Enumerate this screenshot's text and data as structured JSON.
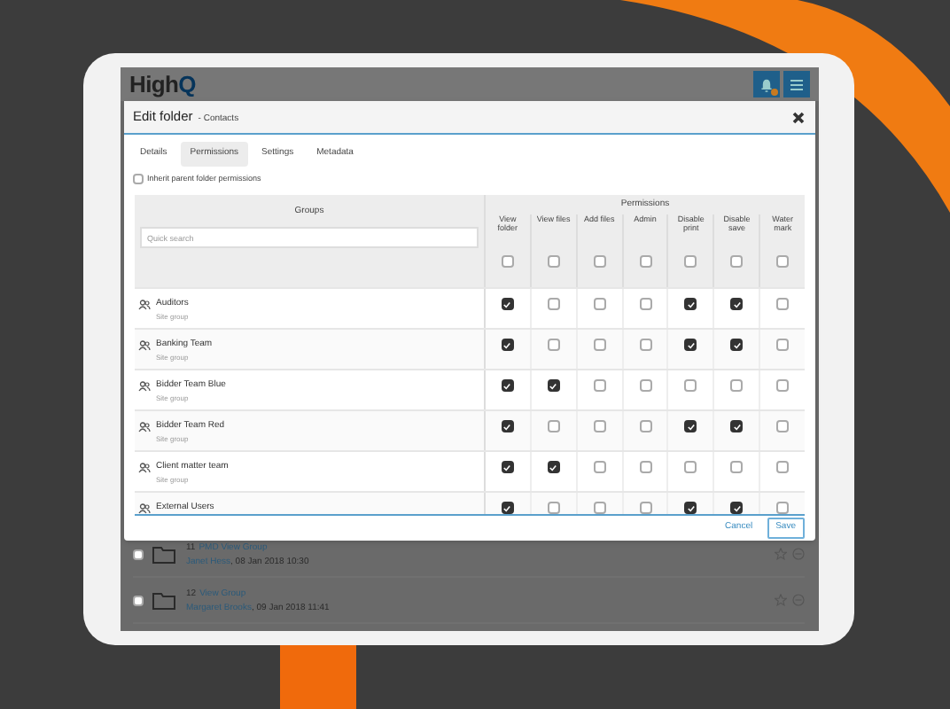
{
  "app": {
    "logo": "High",
    "logo_accent": "Q",
    "notification_badge": true
  },
  "dialog": {
    "title": "Edit folder",
    "subtitle": "- Contacts",
    "tabs": [
      {
        "label": "Details",
        "selected": false
      },
      {
        "label": "Permissions",
        "selected": true
      },
      {
        "label": "Settings",
        "selected": false
      },
      {
        "label": "Metadata",
        "selected": false
      }
    ],
    "inherit": {
      "label": "Inherit parent folder permissions",
      "checked": false
    },
    "table": {
      "groups_heading": "Groups",
      "permissions_heading": "Permissions",
      "search": {
        "placeholder": "Quick search"
      },
      "columns": [
        {
          "label": "View folder",
          "checked": false
        },
        {
          "label": "View files",
          "checked": false
        },
        {
          "label": "Add files",
          "checked": false
        },
        {
          "label": "Admin",
          "checked": false
        },
        {
          "label": "Disable print",
          "checked": false
        },
        {
          "label": "Disable save",
          "checked": false
        },
        {
          "label": "Water mark",
          "checked": false
        }
      ],
      "rows": [
        {
          "name": "Auditors",
          "type": "Site group",
          "perms": [
            true,
            false,
            false,
            false,
            true,
            true,
            false
          ]
        },
        {
          "name": "Banking Team",
          "type": "Site group",
          "perms": [
            true,
            false,
            false,
            false,
            true,
            true,
            false
          ]
        },
        {
          "name": "Bidder Team Blue",
          "type": "Site group",
          "perms": [
            true,
            true,
            false,
            false,
            false,
            false,
            false
          ]
        },
        {
          "name": "Bidder Team Red",
          "type": "Site group",
          "perms": [
            true,
            false,
            false,
            false,
            true,
            true,
            false
          ]
        },
        {
          "name": "Client matter team",
          "type": "Site group",
          "perms": [
            true,
            true,
            false,
            false,
            false,
            false,
            false
          ]
        },
        {
          "name": "External Users",
          "perms": [
            true,
            false,
            false,
            false,
            true,
            true,
            false
          ]
        }
      ]
    },
    "buttons": [
      {
        "label": "Cancel",
        "kind": "link"
      },
      {
        "label": "Save",
        "kind": "primary"
      }
    ]
  },
  "folders": [
    {
      "number": "11",
      "name": "PMD View Group",
      "author": "Janet Hess",
      "date": ", 08 Jan 2018 10:30",
      "checked": false
    },
    {
      "number": "12",
      "name": "View Group",
      "author": "Margaret Brooks",
      "date": ", 09 Jan 2018 11:41",
      "checked": false
    }
  ]
}
